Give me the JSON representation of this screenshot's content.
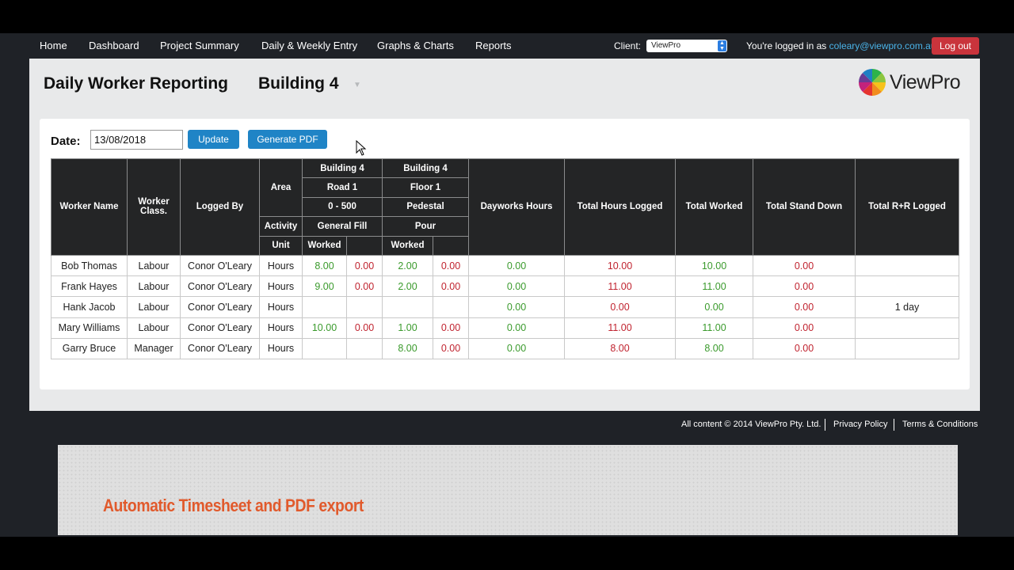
{
  "nav": {
    "items": [
      {
        "label": "Home"
      },
      {
        "label": "Dashboard"
      },
      {
        "label": "Project Summary"
      },
      {
        "label": "Daily & Weekly Entry"
      },
      {
        "label": "Graphs & Charts"
      },
      {
        "label": "Reports"
      }
    ],
    "client_label": "Client:",
    "client_value": "ViewPro",
    "logged_in_prefix": "You're logged in as ",
    "logged_in_email": "coleary@viewpro.com.au",
    "logout_label": "Log out"
  },
  "page": {
    "title": "Daily Worker Reporting",
    "building": "Building 4",
    "logo_text": "ViewPro",
    "date_label": "Date:",
    "date_value": "13/08/2018",
    "update_label": "Update",
    "pdf_label": "Generate PDF"
  },
  "table": {
    "headers": {
      "worker_name": "Worker Name",
      "worker_class": "Worker Class.",
      "logged_by": "Logged By",
      "area": "Area",
      "activity": "Activity",
      "unit": "Unit",
      "dayworks": "Dayworks Hours",
      "total_logged": "Total Hours Logged",
      "total_worked": "Total Worked",
      "total_stand_down": "Total Stand Down",
      "total_rr": "Total R+R Logged"
    },
    "groups": [
      {
        "building": "Building 4",
        "location": "Road 1",
        "range": "0 - 500",
        "activity": "General Fill",
        "unit": "Worked"
      },
      {
        "building": "Building 4",
        "location": "Floor 1",
        "range": "Pedestal",
        "activity": "Pour",
        "unit": "Worked"
      }
    ],
    "rows": [
      {
        "name": "Bob Thomas",
        "class": "Labour",
        "logged_by": "Conor O'Leary",
        "unit": "Hours",
        "g1w": "8.00",
        "g1s": "0.00",
        "g2w": "2.00",
        "g2s": "0.00",
        "dayworks": "0.00",
        "logged": "10.00",
        "worked": "10.00",
        "stand_down": "0.00",
        "rr": ""
      },
      {
        "name": "Frank Hayes",
        "class": "Labour",
        "logged_by": "Conor O'Leary",
        "unit": "Hours",
        "g1w": "9.00",
        "g1s": "0.00",
        "g2w": "2.00",
        "g2s": "0.00",
        "dayworks": "0.00",
        "logged": "11.00",
        "worked": "11.00",
        "stand_down": "0.00",
        "rr": ""
      },
      {
        "name": "Hank Jacob",
        "class": "Labour",
        "logged_by": "Conor O'Leary",
        "unit": "Hours",
        "g1w": "",
        "g1s": "",
        "g2w": "",
        "g2s": "",
        "dayworks": "0.00",
        "logged": "0.00",
        "worked": "0.00",
        "stand_down": "0.00",
        "rr": "1 day"
      },
      {
        "name": "Mary Williams",
        "class": "Labour",
        "logged_by": "Conor O'Leary",
        "unit": "Hours",
        "g1w": "10.00",
        "g1s": "0.00",
        "g2w": "1.00",
        "g2s": "0.00",
        "dayworks": "0.00",
        "logged": "11.00",
        "worked": "11.00",
        "stand_down": "0.00",
        "rr": ""
      },
      {
        "name": "Garry Bruce",
        "class": "Manager",
        "logged_by": "Conor O'Leary",
        "unit": "Hours",
        "g1w": "",
        "g1s": "",
        "g2w": "8.00",
        "g2s": "0.00",
        "dayworks": "0.00",
        "logged": "8.00",
        "worked": "8.00",
        "stand_down": "0.00",
        "rr": ""
      }
    ]
  },
  "footer": {
    "copyright": "All content © 2014 ViewPro Pty. Ltd.",
    "privacy": "Privacy Policy",
    "terms": "Terms & Conditions"
  },
  "banner": {
    "text": "Automatic Timesheet and PDF export"
  },
  "colors": {
    "green": "#3a9a2c",
    "red": "#c0232f",
    "button_blue": "#1f84c6",
    "logout_red": "#c9343c",
    "banner_orange": "#e15a2c"
  }
}
